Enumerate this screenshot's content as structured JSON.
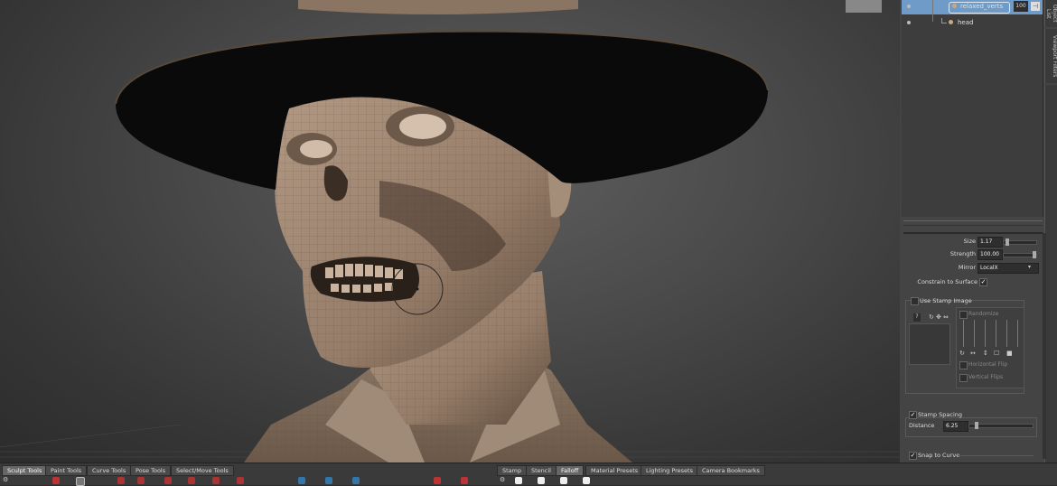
{
  "layers": {
    "items": [
      {
        "name": "relaxed_verts",
        "value": "100",
        "selected": true
      },
      {
        "name": "head",
        "selected": false
      }
    ],
    "side_tabs": [
      "Object List",
      "Viewport Filters"
    ]
  },
  "properties": {
    "size_label": "Size",
    "size_value": "1.17",
    "strength_label": "Strength",
    "strength_value": "100.00",
    "mirror_label": "Mirror",
    "mirror_value": "LocalX",
    "constrain_label": "Constrain to Surface",
    "use_stamp_label": "Use Stamp Image",
    "randomize_label": "Randomize",
    "hflip_label": "Horizontal Flip",
    "vflip_label": "Vertical Flips",
    "stamp_spacing_label": "Stamp Spacing",
    "distance_label": "Distance",
    "distance_value": "6.25",
    "snap_label": "Snap to Curve"
  },
  "tray": {
    "left_tabs": [
      "Sculpt Tools",
      "Paint Tools",
      "Curve Tools",
      "Pose Tools",
      "Select/Move Tools"
    ],
    "left_active": 0,
    "right_tabs": [
      "Stamp",
      "Stencil",
      "Falloff",
      "Material Presets",
      "Lighting Presets",
      "Camera Bookmarks"
    ],
    "right_active": 2
  },
  "colors": {
    "selection": "#6e9bc8",
    "mesh_skin": "#9b8471",
    "hat": "#0a0a0a"
  }
}
